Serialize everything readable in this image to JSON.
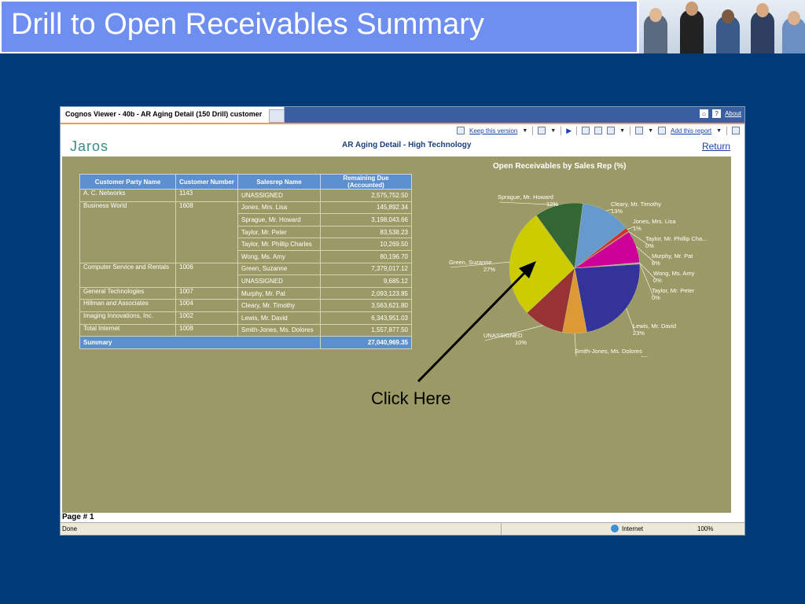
{
  "slide": {
    "title": "Drill to Open Receivables Summary",
    "callout": "Click Here"
  },
  "viewer": {
    "tab_title": "Cognos Viewer - 40b - AR Aging Detail (150 Drill) customer",
    "about_label": "About",
    "toolbar": {
      "keep_version": "Keep this version",
      "add_report": "Add this report"
    },
    "brand": "Jaros",
    "report_title": "AR Aging Detail - High Technology",
    "return_label": "Return",
    "page_number": "Page # 1",
    "status": {
      "done": "Done",
      "zone": "Internet",
      "zoom": "100%"
    }
  },
  "table": {
    "headers": [
      "Customer Party Name",
      "Customer Number",
      "Salesrep Name",
      "Remaining Due (Accounted)"
    ],
    "groups": [
      {
        "customer": "A. C. Networks",
        "number": "1143",
        "rows": [
          [
            "UNASSIGNED",
            "2,575,752.50"
          ]
        ]
      },
      {
        "customer": "Business World",
        "number": "1608",
        "rows": [
          [
            "Jones, Mrs. Lisa",
            "145,892.34"
          ],
          [
            "Sprague, Mr. Howard",
            "3,198,043.66"
          ],
          [
            "Taylor, Mr. Peter",
            "83,538.23"
          ],
          [
            "Taylor, Mr. Phillip Charles",
            "10,269.50"
          ],
          [
            "Wong, Ms. Amy",
            "80,196.70"
          ]
        ]
      },
      {
        "customer": "Computer Service and Rentals",
        "number": "1006",
        "rows": [
          [
            "Green, Suzanne",
            "7,379,017.12"
          ],
          [
            "UNASSIGNED",
            "9,685.12"
          ]
        ]
      },
      {
        "customer": "General Technologies",
        "number": "1007",
        "rows": [
          [
            "Murphy, Mr. Pat",
            "2,093,123.85"
          ]
        ]
      },
      {
        "customer": "Hillman and Associates",
        "number": "1004",
        "rows": [
          [
            "Cleary, Mr. Timothy",
            "3,563,621.80"
          ]
        ]
      },
      {
        "customer": "Imaging Innovations, Inc.",
        "number": "1002",
        "rows": [
          [
            "Lewis, Mr. David",
            "6,343,951.03"
          ]
        ]
      },
      {
        "customer": "Total Internet",
        "number": "1008",
        "rows": [
          [
            "Smith-Jones, Ms. Dolores",
            "1,557,877.50"
          ]
        ]
      }
    ],
    "summary_label": "Summary",
    "summary_value": "27,040,969.35"
  },
  "chart_data": {
    "type": "pie",
    "title": "Open Receivables by Sales Rep (%)",
    "series": [
      {
        "name": "Cleary, Mr. Timothy",
        "value": 13,
        "label": "13%",
        "color": "#6699cc"
      },
      {
        "name": "Jones, Mrs. Lisa",
        "value": 1,
        "label": "1%",
        "color": "#cc3333"
      },
      {
        "name": "Taylor, Mr. Phillip Cha...",
        "value": 0,
        "label": "0%",
        "color": "#e07030"
      },
      {
        "name": "Murphy, Mr. Pat",
        "value": 8,
        "label": "8%",
        "color": "#cc0099"
      },
      {
        "name": "Wong, Ms. Amy",
        "value": 0,
        "label": "0%",
        "color": "#99cccc"
      },
      {
        "name": "Taylor, Mr. Peter",
        "value": 0,
        "label": "0%",
        "color": "#9966cc"
      },
      {
        "name": "Lewis, Mr. David",
        "value": 23,
        "label": "23%",
        "color": "#333399"
      },
      {
        "name": "Smith-Jones, Ms. Dolores",
        "value": 6,
        "label": "6%",
        "color": "#dd9933"
      },
      {
        "name": "UNASSIGNED",
        "value": 10,
        "label": "10%",
        "color": "#993333"
      },
      {
        "name": "Green, Suzanne",
        "value": 27,
        "label": "27%",
        "color": "#cccc00"
      },
      {
        "name": "Sprague, Mr. Howard",
        "value": 12,
        "label": "12%",
        "color": "#336633"
      }
    ]
  }
}
